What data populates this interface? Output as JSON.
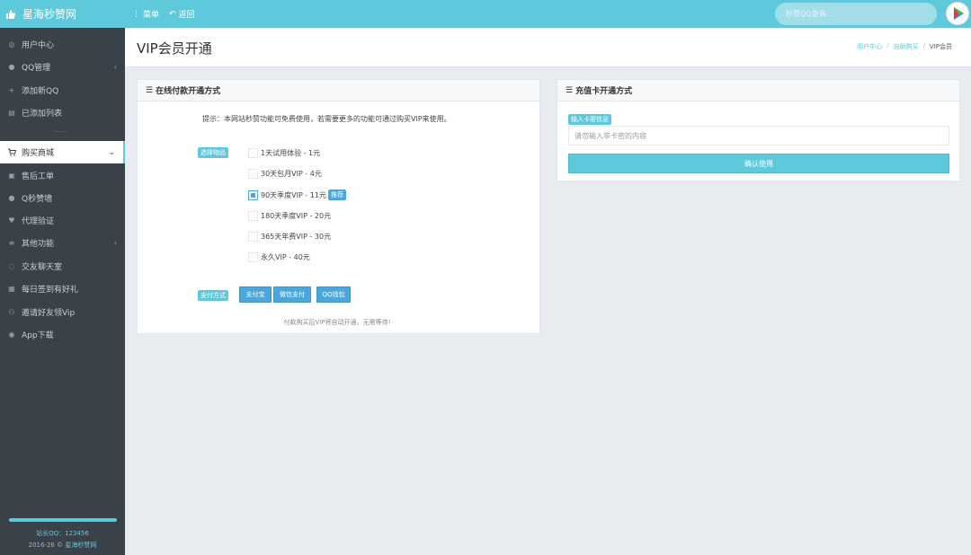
{
  "app": {
    "brand": "星海秒赞网",
    "nav": {
      "menu": "菜单",
      "back": "返回"
    },
    "search_placeholder": "秒赞QQ查询..."
  },
  "sidebar": {
    "items": [
      {
        "label": "用户中心",
        "icon": "dashboard-icon"
      },
      {
        "label": "QQ管理",
        "icon": "qq-icon",
        "has_caret": true
      },
      {
        "label": "添加新QQ",
        "icon": "plus-icon"
      },
      {
        "label": "已添加列表",
        "icon": "list-icon"
      },
      {
        "label": "购买商城",
        "icon": "cart-icon",
        "active": true,
        "has_caret": true
      },
      {
        "label": "售后工单",
        "icon": "ticket-icon"
      },
      {
        "label": "Q秒赞墙",
        "icon": "qq-icon"
      },
      {
        "label": "代理验证",
        "icon": "heart-icon"
      },
      {
        "label": "其他功能",
        "icon": "menu-icon",
        "has_caret": true
      },
      {
        "label": "交友聊天室",
        "icon": "chat-icon"
      },
      {
        "label": "每日签到有好礼",
        "icon": "calendar-icon"
      },
      {
        "label": "邀请好友领Vip",
        "icon": "user-add-icon"
      },
      {
        "label": "App下载",
        "icon": "eye-icon"
      }
    ],
    "footer": {
      "qq_line": "站长QQ：123456",
      "copyright_prefix": "2016-26 © ",
      "copyright_name": "星海秒赞网"
    }
  },
  "page": {
    "title": "VIP会员开通",
    "breadcrumb": [
      "用户中心",
      "自助购买",
      "VIP会员"
    ]
  },
  "online_panel": {
    "title": "在线付款开通方式",
    "tip": "提示：本网站秒赞功能可免费使用，若需要更多的功能可通过购买VIP来使用。",
    "select_label": "选择物品",
    "options": [
      {
        "label": "1天试用体验 - 1元",
        "checked": false
      },
      {
        "label": "30天包月VIP - 4元",
        "checked": false
      },
      {
        "label": "90天季度VIP - 11元",
        "checked": true,
        "badge": "推荐"
      },
      {
        "label": "180天季度VIP - 20元",
        "checked": false
      },
      {
        "label": "365天年费VIP - 30元",
        "checked": false
      },
      {
        "label": "永久VIP - 40元",
        "checked": false
      }
    ],
    "pay_label": "支付方式",
    "pay_buttons": [
      "支付宝",
      "微信支付",
      "QQ钱包"
    ],
    "note": "付款购买后VIP将自动开通，无需等待！"
  },
  "card_panel": {
    "title": "充值卡开通方式",
    "input_label": "输入卡密信息",
    "input_placeholder": "请勿输入非卡密的内容",
    "input_value": "",
    "confirm": "确认使用"
  },
  "colors": {
    "accent": "#5fc9dc",
    "sidebar_bg": "#394249",
    "button_blue": "#4aa7dd",
    "page_bg": "#e8ebef"
  }
}
